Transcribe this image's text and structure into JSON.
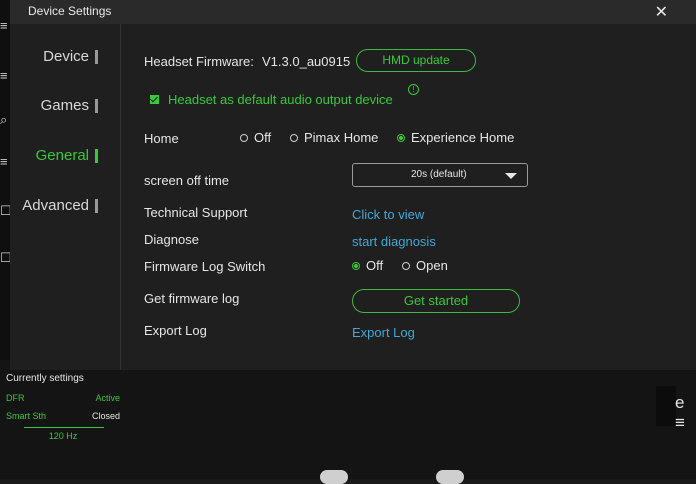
{
  "window": {
    "title": "Device Settings",
    "close_glyph": "✕"
  },
  "sidebar": {
    "items": [
      {
        "label": "Device",
        "active": false
      },
      {
        "label": "Games",
        "active": false
      },
      {
        "label": "General",
        "active": true
      },
      {
        "label": "Advanced",
        "active": false
      }
    ]
  },
  "firmware": {
    "label": "Headset Firmware:",
    "version": "V1.3.0_au0915",
    "update_button": "HMD update"
  },
  "audio_default": {
    "label": "Headset as default audio output device",
    "checked": true
  },
  "home": {
    "label": "Home",
    "options": [
      "Off",
      "Pimax Home",
      "Experience Home"
    ],
    "selected": "Experience Home"
  },
  "screen_off": {
    "label": "screen off time",
    "value": "20s (default)"
  },
  "support": {
    "label": "Technical Support",
    "link": "Click to view"
  },
  "diagnose": {
    "label": "Diagnose",
    "link": "start diagnosis"
  },
  "firmware_log_switch": {
    "label": "Firmware Log Switch",
    "options": [
      "Off",
      "Open"
    ],
    "selected": "Off"
  },
  "firmware_log": {
    "label": "Get firmware log",
    "button": "Get started"
  },
  "export_log": {
    "label": "Export Log",
    "link": "Export Log"
  },
  "status_panel": {
    "title": "Currently settings",
    "rows": [
      {
        "key": "DFR",
        "value": "Active",
        "value_color": "#39c83a"
      },
      {
        "key": "Smart Sth",
        "value": "Closed",
        "value_color": "#e6e6e6"
      }
    ],
    "refresh": "120 Hz"
  },
  "colors": {
    "accent": "#39c83a",
    "link": "#3fa9d8",
    "background": "#1f1f1f"
  }
}
